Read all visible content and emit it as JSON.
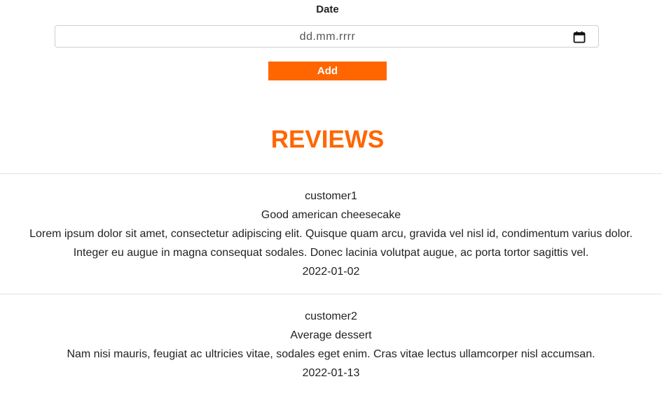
{
  "form": {
    "date_label": "Date",
    "date_placeholder": "dd.mm.rrrr",
    "add_label": "Add"
  },
  "reviews": {
    "heading": "REVIEWS",
    "items": [
      {
        "customer": "customer1",
        "title": "Good american cheesecake",
        "body_line1": "Lorem ipsum dolor sit amet, consectetur adipiscing elit. Quisque quam arcu, gravida vel nisl id, condimentum varius dolor.",
        "body_line2": "Integer eu augue in magna consequat sodales. Donec lacinia volutpat augue, ac porta tortor sagittis vel.",
        "date": "2022-01-02"
      },
      {
        "customer": "customer2",
        "title": "Average dessert",
        "body_line1": "Nam nisi mauris, feugiat ac ultricies vitae, sodales eget enim. Cras vitae lectus ullamcorper nisl accumsan.",
        "date": "2022-01-13"
      }
    ]
  },
  "colors": {
    "accent": "#ff6600"
  },
  "icons": {
    "date_picker": "calendar-icon"
  }
}
